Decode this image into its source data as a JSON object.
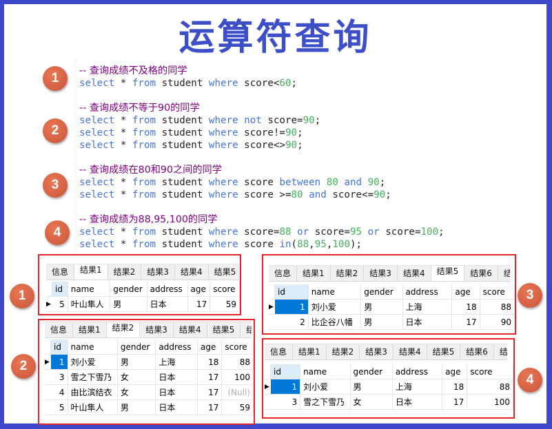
{
  "title": "运算符查询",
  "colors": {
    "frame": "#3f47cc",
    "title": "#3d4fc8",
    "badge": "#d9603f",
    "panel_border": "#e3242b",
    "comment": "#800080",
    "keyword": "#4472e8",
    "number": "#41b15a",
    "selected_cell": "#0078d7"
  },
  "sections": [
    {
      "badge": "1",
      "comment": "-- 查询成绩不及格的同学",
      "lines": [
        [
          [
            "kw",
            "select"
          ],
          [
            "t",
            " * "
          ],
          [
            "kw",
            "from"
          ],
          [
            "t",
            " student "
          ],
          [
            "kw",
            "where"
          ],
          [
            "t",
            " score<"
          ],
          [
            "num",
            "60"
          ],
          [
            "t",
            ";"
          ]
        ]
      ]
    },
    {
      "badge": "2",
      "comment": "-- 查询成绩不等于90的同学",
      "lines": [
        [
          [
            "kw",
            "select"
          ],
          [
            "t",
            " * "
          ],
          [
            "kw",
            "from"
          ],
          [
            "t",
            " student "
          ],
          [
            "kw",
            "where"
          ],
          [
            "t",
            " "
          ],
          [
            "kw",
            "not"
          ],
          [
            "t",
            " score="
          ],
          [
            "num",
            "90"
          ],
          [
            "t",
            ";"
          ]
        ],
        [
          [
            "kw",
            "select"
          ],
          [
            "t",
            " * "
          ],
          [
            "kw",
            "from"
          ],
          [
            "t",
            " student "
          ],
          [
            "kw",
            "where"
          ],
          [
            "t",
            " score!="
          ],
          [
            "num",
            "90"
          ],
          [
            "t",
            ";"
          ]
        ],
        [
          [
            "kw",
            "select"
          ],
          [
            "t",
            " * "
          ],
          [
            "kw",
            "from"
          ],
          [
            "t",
            " student "
          ],
          [
            "kw",
            "where"
          ],
          [
            "t",
            " score<>"
          ],
          [
            "num",
            "90"
          ],
          [
            "t",
            ";"
          ]
        ]
      ]
    },
    {
      "badge": "3",
      "comment": "-- 查询成绩在80和90之间的同学",
      "lines": [
        [
          [
            "kw",
            "select"
          ],
          [
            "t",
            " * "
          ],
          [
            "kw",
            "from"
          ],
          [
            "t",
            " student "
          ],
          [
            "kw",
            "where"
          ],
          [
            "t",
            " score "
          ],
          [
            "kw",
            "between"
          ],
          [
            "t",
            " "
          ],
          [
            "num",
            "80"
          ],
          [
            "t",
            " "
          ],
          [
            "kw",
            "and"
          ],
          [
            "t",
            " "
          ],
          [
            "num",
            "90"
          ],
          [
            "t",
            ";"
          ]
        ],
        [
          [
            "kw",
            "select"
          ],
          [
            "t",
            " * "
          ],
          [
            "kw",
            "from"
          ],
          [
            "t",
            " student "
          ],
          [
            "kw",
            "where"
          ],
          [
            "t",
            " score >="
          ],
          [
            "num",
            "80"
          ],
          [
            "t",
            " "
          ],
          [
            "kw",
            "and"
          ],
          [
            "t",
            " score<="
          ],
          [
            "num",
            "90"
          ],
          [
            "t",
            ";"
          ]
        ]
      ]
    },
    {
      "badge": "4",
      "comment": "-- 查询成绩为88,95,100的同学",
      "lines": [
        [
          [
            "kw",
            "select"
          ],
          [
            "t",
            " * "
          ],
          [
            "kw",
            "from"
          ],
          [
            "t",
            " student "
          ],
          [
            "kw",
            "where"
          ],
          [
            "t",
            " score="
          ],
          [
            "num",
            "88"
          ],
          [
            "t",
            " "
          ],
          [
            "kw",
            "or"
          ],
          [
            "t",
            " score="
          ],
          [
            "num",
            "95"
          ],
          [
            "t",
            " "
          ],
          [
            "kw",
            "or"
          ],
          [
            "t",
            " score="
          ],
          [
            "num",
            "100"
          ],
          [
            "t",
            ";"
          ]
        ],
        [
          [
            "kw",
            "select"
          ],
          [
            "t",
            " * "
          ],
          [
            "kw",
            "from"
          ],
          [
            "t",
            " student "
          ],
          [
            "kw",
            "where"
          ],
          [
            "t",
            " score "
          ],
          [
            "kw",
            "in"
          ],
          [
            "t",
            "("
          ],
          [
            "num",
            "88"
          ],
          [
            "t",
            ","
          ],
          [
            "num",
            "95"
          ],
          [
            "t",
            ","
          ],
          [
            "num",
            "100"
          ],
          [
            "t",
            ");"
          ]
        ]
      ]
    }
  ],
  "columns": [
    "id",
    "name",
    "gender",
    "address",
    "age",
    "score"
  ],
  "results": [
    {
      "badge": "1",
      "tabs": [
        "信息",
        "结果1",
        "结果2",
        "结果3",
        "结果4",
        "结果5"
      ],
      "active_tab": 1,
      "rows": [
        [
          "5",
          "叶山隼人",
          "男",
          "日本",
          "17",
          "59"
        ]
      ]
    },
    {
      "badge": "2",
      "tabs": [
        "信息",
        "结果1",
        "结果2",
        "结果3",
        "结果4",
        "结果5",
        "结"
      ],
      "active_tab": 2,
      "rows": [
        [
          "1",
          "刘小爱",
          "男",
          "上海",
          "18",
          "88"
        ],
        [
          "3",
          "雪之下雪乃",
          "女",
          "日本",
          "17",
          "100"
        ],
        [
          "4",
          "由比滨结衣",
          "女",
          "日本",
          "17",
          "(Null)"
        ],
        [
          "5",
          "叶山隼人",
          "男",
          "日本",
          "17",
          "59"
        ]
      ]
    },
    {
      "badge": "3",
      "tabs": [
        "信息",
        "结果1",
        "结果2",
        "结果3",
        "结果4",
        "结果5",
        "结果6",
        "结"
      ],
      "active_tab": 5,
      "rows": [
        [
          "1",
          "刘小爱",
          "男",
          "上海",
          "18",
          "88"
        ],
        [
          "2",
          "比企谷八幡",
          "男",
          "日本",
          "17",
          "90"
        ]
      ]
    },
    {
      "badge": "4",
      "tabs": [
        "信息",
        "结果1",
        "结果2",
        "结果3",
        "结果4",
        "结果5",
        "结果6",
        "结"
      ],
      "active_tab": -1,
      "rows": [
        [
          "1",
          "刘小爱",
          "男",
          "上海",
          "18",
          "88"
        ],
        [
          "3",
          "雪之下雪乃",
          "女",
          "日本",
          "17",
          "100"
        ]
      ]
    }
  ]
}
